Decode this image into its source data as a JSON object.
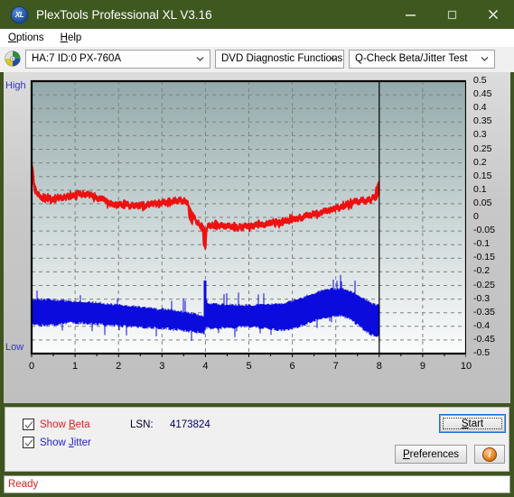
{
  "window": {
    "title": "PlexTools Professional XL V3.16",
    "app_icon": "xl-disc-icon",
    "icon_text": "XL",
    "titlebar_color": "#3f5820",
    "minimize_label": "—",
    "maximize_label": "□",
    "close_label": "✕"
  },
  "menu": {
    "items": [
      {
        "label": "Options",
        "accel": "O"
      },
      {
        "label": "Help",
        "accel": "H"
      }
    ]
  },
  "toolbar": {
    "drive_icon": "cd-disc-icon",
    "drive": {
      "value": "HA:7 ID:0  PX-760A"
    },
    "function": {
      "value": "DVD Diagnostic Functions"
    },
    "test": {
      "value": "Q-Check Beta/Jitter Test"
    }
  },
  "chart_labels": {
    "high": "High",
    "low": "Low"
  },
  "controls": {
    "show_beta": {
      "label_pre": "Show ",
      "accel": "B",
      "label_post": "eta",
      "checked": true,
      "color": "#e02020"
    },
    "show_jitter": {
      "label_pre": "Show ",
      "accel": "J",
      "label_post": "itter",
      "checked": true,
      "color": "#2222cc"
    },
    "lsn_label": "LSN:",
    "lsn_value": "4173824",
    "start_pre": "",
    "start_accel": "S",
    "start_post": "tart",
    "prefs_pre": "",
    "prefs_accel": "P",
    "prefs_post": "references",
    "info_label": "i",
    "info_icon": "info-icon"
  },
  "status": {
    "text": "Ready"
  },
  "chart_data": {
    "type": "line",
    "title": "Q-Check Beta/Jitter Test",
    "xlabel": "",
    "ylabel": "",
    "xlim": [
      0,
      10
    ],
    "ylim": [
      -0.5,
      0.5
    ],
    "xticks": [
      0,
      1,
      2,
      3,
      4,
      5,
      6,
      7,
      8,
      9,
      10
    ],
    "yticks": [
      0.5,
      0.45,
      0.4,
      0.35,
      0.3,
      0.25,
      0.2,
      0.15,
      0.1,
      0.05,
      0,
      -0.05,
      -0.1,
      -0.15,
      -0.2,
      -0.25,
      -0.3,
      -0.35,
      -0.4,
      -0.45,
      -0.5
    ],
    "grid": true,
    "grid_style": "dashed",
    "grid_color": "#808080",
    "y_left_axis_labels": [
      "High",
      "Low"
    ],
    "background_gradient": [
      "#93a9ab",
      "#fbfcfc"
    ],
    "data_end_marker_x": 8,
    "legend": [
      "Show Beta",
      "Show Jitter"
    ],
    "series": [
      {
        "name": "Beta",
        "color": "#ee1111",
        "band": true,
        "x": [
          0.0,
          0.05,
          0.1,
          0.15,
          0.2,
          0.25,
          0.3,
          0.4,
          0.5,
          0.6,
          0.7,
          0.8,
          0.9,
          1.0,
          1.1,
          1.2,
          1.3,
          1.4,
          1.5,
          1.6,
          1.7,
          1.8,
          1.9,
          2.0,
          2.1,
          2.2,
          2.3,
          2.4,
          2.5,
          2.6,
          2.7,
          2.8,
          2.9,
          3.0,
          3.1,
          3.2,
          3.3,
          3.4,
          3.5,
          3.6,
          3.65,
          3.7,
          3.8,
          3.9,
          3.95,
          3.98,
          4.0,
          4.02,
          4.05,
          4.1,
          4.2,
          4.3,
          4.4,
          4.5,
          4.6,
          4.7,
          4.8,
          4.9,
          5.0,
          5.1,
          5.2,
          5.3,
          5.4,
          5.5,
          5.6,
          5.7,
          5.8,
          5.9,
          6.0,
          6.1,
          6.2,
          6.3,
          6.4,
          6.5,
          6.6,
          6.7,
          6.8,
          6.9,
          7.0,
          7.1,
          7.2,
          7.3,
          7.4,
          7.5,
          7.6,
          7.7,
          7.8,
          7.9,
          8.0
        ],
        "y_mid": [
          0.155,
          0.12,
          0.098,
          0.082,
          0.075,
          0.072,
          0.07,
          0.068,
          0.07,
          0.072,
          0.074,
          0.076,
          0.08,
          0.084,
          0.086,
          0.086,
          0.084,
          0.08,
          0.074,
          0.066,
          0.058,
          0.052,
          0.048,
          0.046,
          0.046,
          0.045,
          0.044,
          0.043,
          0.042,
          0.043,
          0.045,
          0.048,
          0.05,
          0.052,
          0.054,
          0.058,
          0.062,
          0.064,
          0.062,
          0.05,
          0.03,
          0.01,
          -0.015,
          -0.03,
          -0.045,
          -0.06,
          -0.078,
          -0.05,
          -0.035,
          -0.03,
          -0.028,
          -0.028,
          -0.03,
          -0.032,
          -0.034,
          -0.036,
          -0.036,
          -0.034,
          -0.032,
          -0.03,
          -0.028,
          -0.026,
          -0.024,
          -0.022,
          -0.02,
          -0.018,
          -0.015,
          -0.012,
          -0.008,
          -0.004,
          0.0,
          0.004,
          0.008,
          0.012,
          0.016,
          0.02,
          0.024,
          0.028,
          0.032,
          0.038,
          0.044,
          0.05,
          0.056,
          0.06,
          0.062,
          0.062,
          0.064,
          0.072,
          0.092
        ],
        "spread": 0.016
      },
      {
        "name": "Jitter",
        "color": "#0b0bdd",
        "band": true,
        "x": [
          0.0,
          0.05,
          0.1,
          0.2,
          0.3,
          0.4,
          0.5,
          0.6,
          0.7,
          0.8,
          0.9,
          1.0,
          1.1,
          1.2,
          1.3,
          1.4,
          1.5,
          1.6,
          1.7,
          1.8,
          1.9,
          2.0,
          2.1,
          2.2,
          2.3,
          2.4,
          2.5,
          2.6,
          2.7,
          2.8,
          2.9,
          3.0,
          3.1,
          3.2,
          3.3,
          3.4,
          3.5,
          3.6,
          3.7,
          3.8,
          3.9,
          3.98,
          4.0,
          4.02,
          4.05,
          4.1,
          4.2,
          4.3,
          4.4,
          4.5,
          4.6,
          4.7,
          4.8,
          4.9,
          5.0,
          5.1,
          5.2,
          5.3,
          5.4,
          5.5,
          5.6,
          5.7,
          5.8,
          5.9,
          6.0,
          6.1,
          6.2,
          6.3,
          6.4,
          6.5,
          6.6,
          6.7,
          6.8,
          6.9,
          7.0,
          7.1,
          7.2,
          7.3,
          7.4,
          7.5,
          7.6,
          7.7,
          7.8,
          7.9,
          8.0
        ],
        "y_top": [
          -0.305,
          -0.3,
          -0.298,
          -0.3,
          -0.302,
          -0.3,
          -0.302,
          -0.305,
          -0.305,
          -0.306,
          -0.308,
          -0.308,
          -0.308,
          -0.31,
          -0.31,
          -0.312,
          -0.312,
          -0.314,
          -0.316,
          -0.318,
          -0.32,
          -0.32,
          -0.322,
          -0.324,
          -0.326,
          -0.326,
          -0.328,
          -0.33,
          -0.332,
          -0.334,
          -0.336,
          -0.336,
          -0.338,
          -0.34,
          -0.342,
          -0.344,
          -0.346,
          -0.348,
          -0.352,
          -0.356,
          -0.36,
          -0.362,
          -0.232,
          -0.3,
          -0.312,
          -0.316,
          -0.318,
          -0.318,
          -0.318,
          -0.32,
          -0.32,
          -0.32,
          -0.322,
          -0.322,
          -0.322,
          -0.322,
          -0.32,
          -0.32,
          -0.32,
          -0.318,
          -0.318,
          -0.316,
          -0.314,
          -0.31,
          -0.306,
          -0.302,
          -0.296,
          -0.29,
          -0.284,
          -0.278,
          -0.272,
          -0.268,
          -0.264,
          -0.262,
          -0.262,
          -0.262,
          -0.264,
          -0.268,
          -0.274,
          -0.282,
          -0.292,
          -0.302,
          -0.312,
          -0.32,
          -0.322
        ],
        "y_bot": [
          -0.39,
          -0.392,
          -0.394,
          -0.396,
          -0.396,
          -0.396,
          -0.394,
          -0.392,
          -0.39,
          -0.388,
          -0.388,
          -0.388,
          -0.388,
          -0.388,
          -0.39,
          -0.39,
          -0.392,
          -0.392,
          -0.394,
          -0.396,
          -0.398,
          -0.398,
          -0.4,
          -0.4,
          -0.402,
          -0.402,
          -0.402,
          -0.404,
          -0.404,
          -0.406,
          -0.406,
          -0.408,
          -0.408,
          -0.41,
          -0.412,
          -0.414,
          -0.416,
          -0.418,
          -0.42,
          -0.422,
          -0.424,
          -0.426,
          -0.4,
          -0.404,
          -0.406,
          -0.408,
          -0.408,
          -0.408,
          -0.406,
          -0.406,
          -0.404,
          -0.404,
          -0.402,
          -0.402,
          -0.402,
          -0.402,
          -0.404,
          -0.406,
          -0.408,
          -0.41,
          -0.412,
          -0.414,
          -0.414,
          -0.412,
          -0.408,
          -0.404,
          -0.398,
          -0.392,
          -0.386,
          -0.38,
          -0.374,
          -0.37,
          -0.366,
          -0.364,
          -0.362,
          -0.362,
          -0.366,
          -0.372,
          -0.382,
          -0.394,
          -0.408,
          -0.42,
          -0.43,
          -0.436,
          -0.438
        ]
      }
    ]
  }
}
